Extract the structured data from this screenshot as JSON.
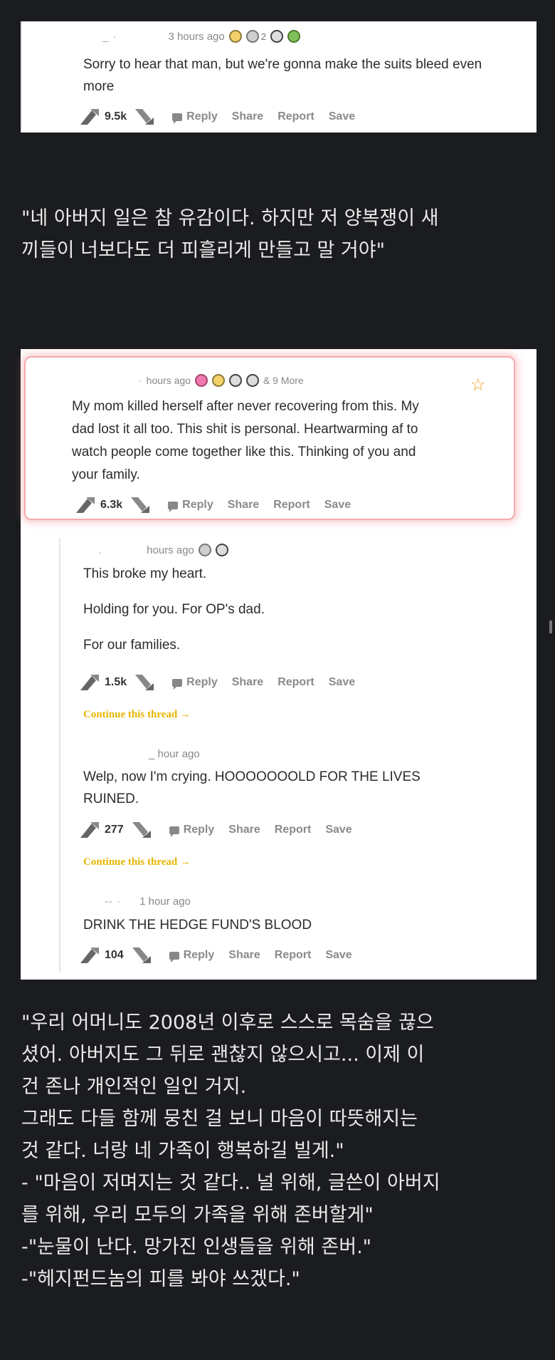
{
  "comment1": {
    "username": "_   ·",
    "meta": "3 hours ago",
    "award_count": "2",
    "body": "Sorry to hear that man, but we're gonna make the suits bleed even more",
    "score": "9.5k"
  },
  "caption1": {
    "lines": [
      "\"네 아버지 일은 참 유감이다. 하지만 저 양복쟁이 새",
      "끼들이 너보다도 더 피흘리게 만들고 말 거야\""
    ]
  },
  "comment2": {
    "username": "·",
    "meta": "hours ago",
    "more": "& 9 More",
    "body_lines": [
      "My mom killed herself after never recovering from this. My",
      "dad lost it all too. This shit is personal. Heartwarming af to",
      "watch people come together like this. Thinking of you and",
      "your family."
    ],
    "score": "6.3k"
  },
  "reply1": {
    "username": ".",
    "meta": "hours ago",
    "body_lines": [
      "This broke my heart.",
      "Holding for you. For OP's dad.",
      "For our families."
    ],
    "score": "1.5k",
    "continue": "Continue this thread →"
  },
  "reply2": {
    "meta": "_ hour ago",
    "body_lines": [
      "Welp, now I'm crying. HOOOOOOOLD FOR THE LIVES",
      "RUINED."
    ],
    "score": "277",
    "continue": "Continue this thread →"
  },
  "reply3": {
    "username": "--    ·",
    "meta": "1 hour ago",
    "body_lines": [
      "DRINK THE HEDGE FUND'S BLOOD"
    ],
    "score": "104"
  },
  "actions": {
    "reply": "Reply",
    "share": "Share",
    "report": "Report",
    "save": "Save"
  },
  "caption2": {
    "lines": [
      "\"우리 어머니도 2008년 이후로 스스로 목숨을 끊으",
      "셨어. 아버지도 그 뒤로 괜찮지 않으시고... 이제 이",
      "건 존나 개인적인 일인 거지.",
      "그래도 다들 함께 뭉친 걸 보니 마음이 따뜻해지는",
      "것 같다. 너랑 네 가족이 행복하길 빌게.\"",
      "- \"마음이 저며지는 것 같다.. 널 위해, 글쓴이 아버지",
      "를 위해, 우리 모두의 가족을 위해 존버할게\"",
      "-\"눈물이 난다. 망가진 인생들을 위해 존버.\"",
      "-\"헤지펀드놈의 피를 봐야 쓰겠다.\""
    ]
  },
  "colors": {
    "background": "#1b1c1f",
    "continue": "#e5b600",
    "highlight": "#f4aab0"
  }
}
